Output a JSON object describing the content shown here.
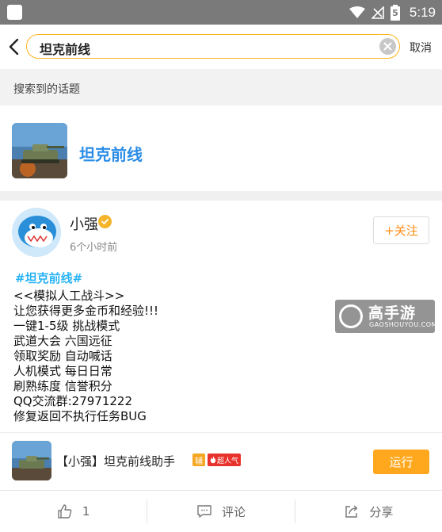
{
  "status_bar": {
    "time": "5:19",
    "battery_level": "5",
    "icons": [
      "app-notification-icon",
      "wifi-icon",
      "signal-icon",
      "battery-icon"
    ]
  },
  "search": {
    "query": "坦克前线",
    "cancel_label": "取消"
  },
  "section": {
    "label": "搜索到的话题"
  },
  "topic": {
    "title": "坦克前线"
  },
  "post": {
    "author": "小强",
    "time": "6个小时前",
    "follow_label": "+关注",
    "hashtag": "#坦克前线#",
    "lines": [
      "<<模拟人工战斗>>",
      "让您获得更多金币和经验!!!",
      "一键1-5级 挑战模式",
      "武道大会 六国远征",
      "领取奖励 自动喊话",
      "人机模式 每日日常",
      "刷熟练度 信誉积分",
      "QQ交流群:27971222",
      "修复返回不执行任务BUG"
    ]
  },
  "watermark": {
    "title": "高手游",
    "subtitle": "GAOSHOUYOU.COM"
  },
  "app_card": {
    "name": "【小强】坦克前线助手",
    "badge_assist": "辅",
    "badge_hot": "超人气",
    "run_label": "运行"
  },
  "actions": {
    "like_count": "1",
    "comment_label": "评论",
    "share_label": "分享"
  },
  "colors": {
    "accent_orange": "#ffa81e",
    "topic_blue": "#2a8ce6",
    "hashtag_blue": "#2ab4f5",
    "status_bar": "#7a7a7a"
  }
}
